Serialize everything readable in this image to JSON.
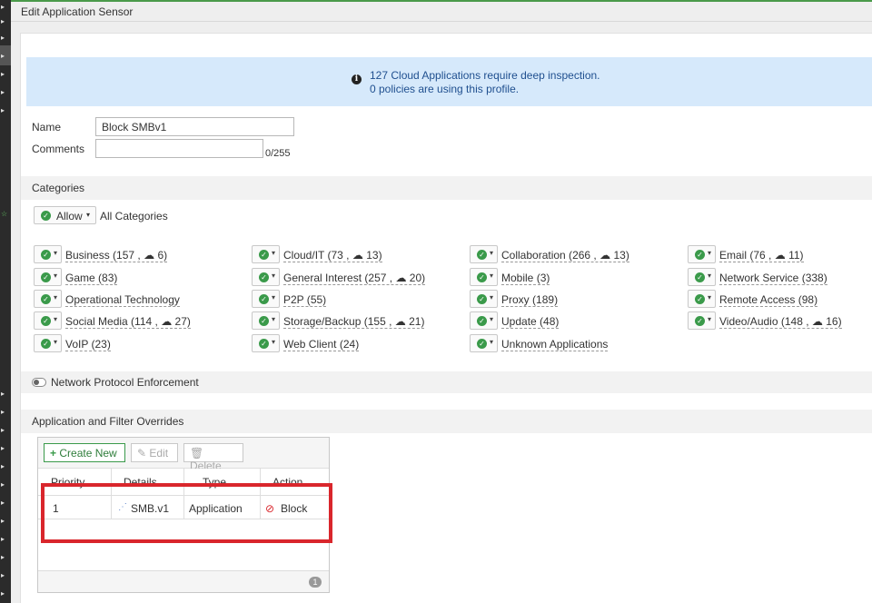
{
  "window": {
    "title": "Edit Application Sensor"
  },
  "banner": {
    "line1": "127 Cloud Applications require deep inspection.",
    "line2": "0 policies are using this profile."
  },
  "form": {
    "name_label": "Name",
    "name_value": "Block SMBv1",
    "comments_label": "Comments",
    "comments_value": "",
    "comments_counter": "0/255"
  },
  "categories": {
    "heading": "Categories",
    "all_action": "Allow",
    "all_label": "All Categories",
    "items": [
      {
        "name": "Business",
        "count": "157",
        "cloud": "6"
      },
      {
        "name": "Cloud/IT",
        "count": "73",
        "cloud": "13"
      },
      {
        "name": "Collaboration",
        "count": "266",
        "cloud": "13"
      },
      {
        "name": "Email",
        "count": "76",
        "cloud": "11"
      },
      {
        "name": "Game",
        "count": "83"
      },
      {
        "name": "General Interest",
        "count": "257",
        "cloud": "20"
      },
      {
        "name": "Mobile",
        "count": "3"
      },
      {
        "name": "Network Service",
        "count": "338"
      },
      {
        "name": "Operational Technology"
      },
      {
        "name": "P2P",
        "count": "55"
      },
      {
        "name": "Proxy",
        "count": "189"
      },
      {
        "name": "Remote Access",
        "count": "98"
      },
      {
        "name": "Social Media",
        "count": "114",
        "cloud": "27"
      },
      {
        "name": "Storage/Backup",
        "count": "155",
        "cloud": "21"
      },
      {
        "name": "Update",
        "count": "48"
      },
      {
        "name": "Video/Audio",
        "count": "148",
        "cloud": "16"
      },
      {
        "name": "VoIP",
        "count": "23"
      },
      {
        "name": "Web Client",
        "count": "24"
      },
      {
        "name": "Unknown Applications"
      }
    ]
  },
  "protocol": {
    "label": "Network Protocol Enforcement",
    "enabled": false
  },
  "overrides": {
    "heading": "Application and Filter Overrides",
    "create_label": "Create New",
    "edit_label": "Edit",
    "delete_label": "Delete",
    "columns": [
      "Priority",
      "Details",
      "Type",
      "Action"
    ],
    "rows": [
      {
        "priority": "1",
        "details": "SMB.v1",
        "type": "Application",
        "action": "Block"
      }
    ],
    "count": "1"
  },
  "colors": {
    "accent": "#3a9a4a",
    "info_bg": "#d6e9fb",
    "highlight": "#d9262c"
  }
}
